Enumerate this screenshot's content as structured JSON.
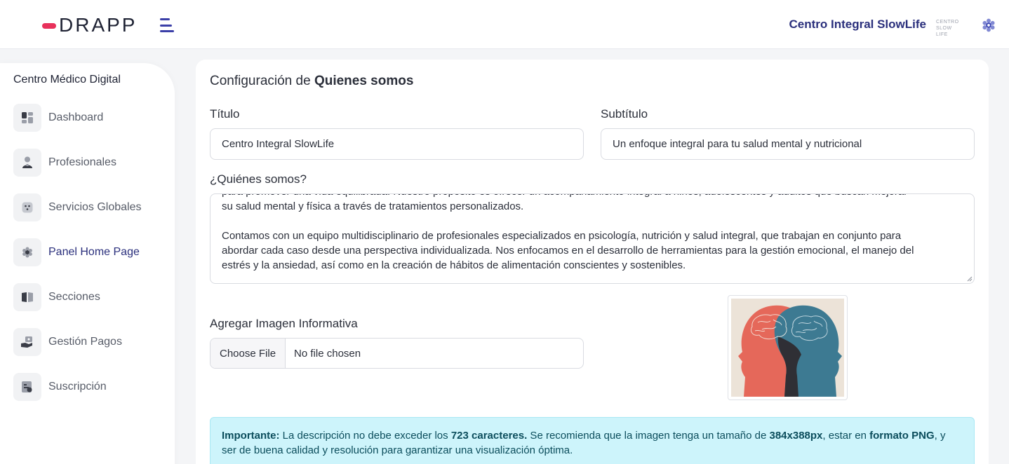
{
  "header": {
    "logo_text": "DRAPP",
    "brand_name": "Centro Integral SlowLife",
    "brand_mini": "CENTRO SLOW LIFE"
  },
  "sidebar": {
    "title": "Centro Médico Digital",
    "items": [
      {
        "label": "Dashboard",
        "icon": "dashboard-icon"
      },
      {
        "label": "Profesionales",
        "icon": "user-icon"
      },
      {
        "label": "Servicios Globales",
        "icon": "services-icon"
      },
      {
        "label": "Panel Home Page",
        "icon": "gear-icon",
        "active": true
      },
      {
        "label": "Secciones",
        "icon": "book-icon"
      },
      {
        "label": "Gestión Pagos",
        "icon": "payment-icon"
      },
      {
        "label": "Suscripción",
        "icon": "subscription-icon"
      }
    ]
  },
  "form": {
    "title_prefix": "Configuración de ",
    "title_bold": "Quienes somos",
    "titulo_label": "Título",
    "titulo_value": "Centro Integral SlowLife",
    "subtitulo_label": "Subtítulo",
    "subtitulo_value": "Un enfoque integral para tu salud mental y nutricional",
    "quienes_label": "¿Quiénes somos?",
    "quienes_lines": [
      "para promover una vida equilibrada. Nuestro propósito es ofrecer un acompañamiento integral a niños, adolescentes y adultos que buscan mejorar",
      "su salud mental y física a través de tratamientos personalizados.",
      "",
      "Contamos con un equipo multidisciplinario de profesionales especializados en psicología, nutrición y salud integral, que trabajan en conjunto para",
      "abordar cada caso desde una perspectiva individualizada. Nos enfocamos en el desarrollo de herramientas para la gestión emocional, el manejo del",
      "estrés y la ansiedad, así como en la creación de hábitos de alimentación conscientes y sostenibles."
    ],
    "imagen_label": "Agregar Imagen Informativa",
    "file_button": "Choose File",
    "file_status": "No file chosen"
  },
  "alert": {
    "prefix": "Importante:",
    "t1": " La descripción no debe exceder los ",
    "b1": "723 caracteres.",
    "t2": " Se recomienda que la imagen tenga un tamaño de ",
    "b2": "384x388px",
    "t3": ", estar en ",
    "b3": "formato PNG",
    "t4": ", y ser de buena calidad y resolución para garantizar una visualización óptima."
  },
  "colors": {
    "accent": "#2a2f7c",
    "logo_red": "#e8315b",
    "alert_bg": "#cdf4fb"
  }
}
